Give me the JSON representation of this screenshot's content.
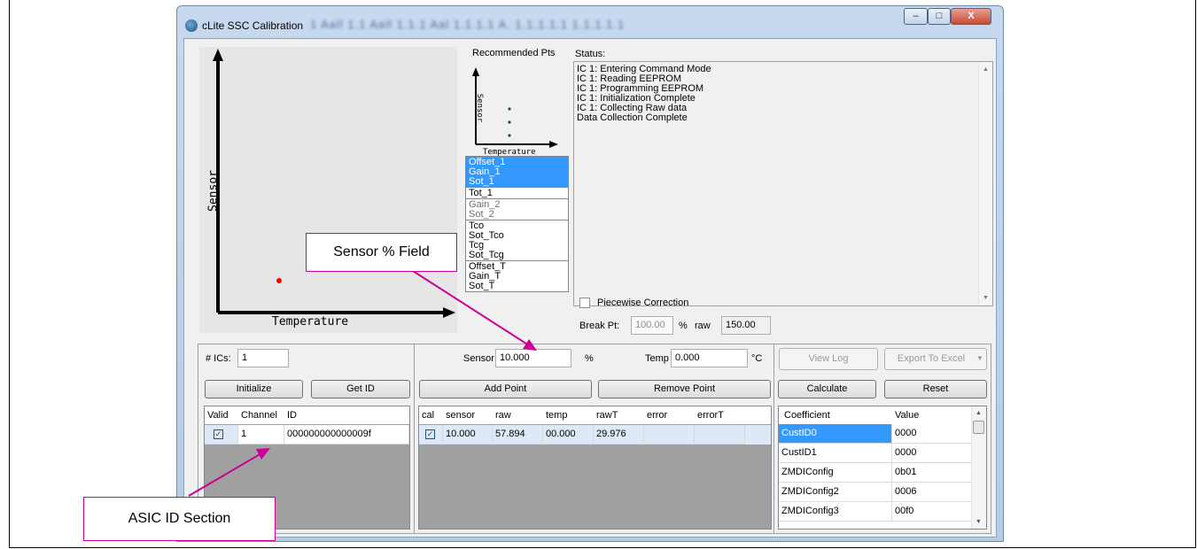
{
  "window": {
    "title": "cLite SSC Calibration",
    "blurred_title": "1 Aall 1.1 Aall 1.1.1 Aal 1.1.1.1 A. 1.1.1.1.1 1.1.1.1.1",
    "minimize_label": "–",
    "maximize_label": "□",
    "close_label": "X"
  },
  "main_graph": {
    "xlabel": "Temperature",
    "ylabel": "Sensor",
    "point_color": "#ff0000"
  },
  "mini_graph": {
    "title": "Recommended Pts",
    "xlabel": "Temperature",
    "ylabel": "Sensor",
    "point_color": "#006400"
  },
  "coefficient_list": {
    "groups": [
      {
        "items": [
          "Offset_1",
          "Gain_1",
          "Sot_1"
        ],
        "selected": true
      },
      {
        "items": [
          "Tot_1"
        ],
        "selected": false
      },
      {
        "items": [
          "Gain_2",
          "Sot_2"
        ],
        "selected": false,
        "disabled": true
      },
      {
        "items": [
          "Tco",
          "Sot_Tco",
          "Tcg",
          "Sot_Tcg"
        ],
        "selected": false
      },
      {
        "items": [
          "Offset_T",
          "Gain_T",
          "Sot_T"
        ],
        "selected": false
      }
    ]
  },
  "status": {
    "label": "Status:",
    "lines": [
      "IC 1: Entering Command Mode",
      "IC 1: Reading EEPROM",
      "IC 1: Programming EEPROM",
      "IC 1: Initialization Complete",
      "IC 1: Collecting Raw data",
      "Data Collection Complete"
    ]
  },
  "piecewise": {
    "label": "Piecewise Correction",
    "checked": false
  },
  "breakpoint": {
    "label": "Break Pt:",
    "value": "100.00",
    "unit": "%",
    "raw_label": "raw",
    "raw_value": "150.00"
  },
  "ics": {
    "label": "# ICs:",
    "value": "1"
  },
  "sensor": {
    "label": "Sensor",
    "value": "10.000",
    "unit": "%"
  },
  "temp": {
    "label": "Temp",
    "value": "0.000",
    "unit": "°C"
  },
  "buttons": {
    "view_log": "View Log",
    "export_excel": "Export To Excel",
    "initialize": "Initialize",
    "get_id": "Get ID",
    "add_point": "Add Point",
    "remove_point": "Remove Point",
    "calculate": "Calculate",
    "reset": "Reset"
  },
  "id_table": {
    "headers": [
      "Valid",
      "Channel",
      "ID"
    ],
    "rows": [
      {
        "valid": true,
        "channel": "1",
        "id": "000000000000009f"
      }
    ]
  },
  "points_table": {
    "headers": [
      "cal",
      "sensor",
      "raw",
      "temp",
      "rawT",
      "error",
      "errorT"
    ],
    "rows": [
      {
        "cal": true,
        "sensor": "10.000",
        "raw": "57.894",
        "temp": "00.000",
        "rawT": "29.976",
        "error": "",
        "errorT": ""
      }
    ]
  },
  "coef_table": {
    "headers": [
      "Coefficient",
      "Value"
    ],
    "rows": [
      {
        "name": "CustID0",
        "value": "0000"
      },
      {
        "name": "CustID1",
        "value": "0000"
      },
      {
        "name": "ZMDIConfig",
        "value": "0b01"
      },
      {
        "name": "ZMDIConfig2",
        "value": "0006"
      },
      {
        "name": "ZMDIConfig3",
        "value": "00f0"
      }
    ]
  },
  "annotations": {
    "sensor_field": "Sensor % Field",
    "asic_id": "ASIC ID Section",
    "color": "#cc0099"
  }
}
